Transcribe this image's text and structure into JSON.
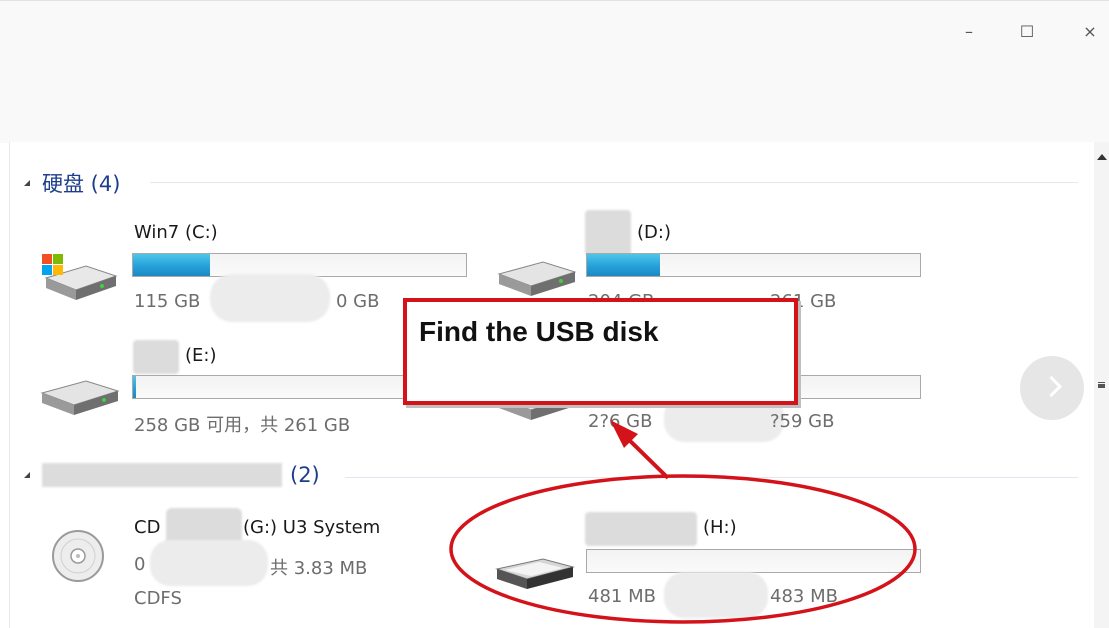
{
  "window": {
    "minimize_label": "–",
    "maximize_label": "☐",
    "close_label": "×"
  },
  "groups": {
    "hard_disks": {
      "label": "硬盘 (4)"
    },
    "removable": {
      "count_label": "(2)"
    }
  },
  "drives": {
    "c": {
      "name": "Win7 (C:)",
      "free_label": "115 GB",
      "total_label": "0 GB",
      "used_fraction": 0.23
    },
    "d": {
      "name": "(D:)",
      "free_label": "204 GB",
      "total_label": "261 GB",
      "used_fraction": 0.22
    },
    "e": {
      "name": "(E:)",
      "space_label": "258 GB 可用，共 261 GB",
      "used_fraction": 0.01
    },
    "f": {
      "free_label": "2?6 GB",
      "total_label": "?59 GB"
    },
    "g": {
      "name_left": "CD",
      "name_right": "(G:) U3 System",
      "line2_left": "0",
      "line2_right": "共 3.83 MB",
      "fs": "CDFS"
    },
    "h": {
      "name": "(H:)",
      "free_label": "481 MB",
      "total_label": "483 MB",
      "used_fraction": 0.0
    }
  },
  "annotation": {
    "callout_text": "Find the USB disk",
    "color": "#d4121a"
  },
  "colors": {
    "bar_fill": "#26a0da",
    "group_header": "#1e3e8c"
  }
}
